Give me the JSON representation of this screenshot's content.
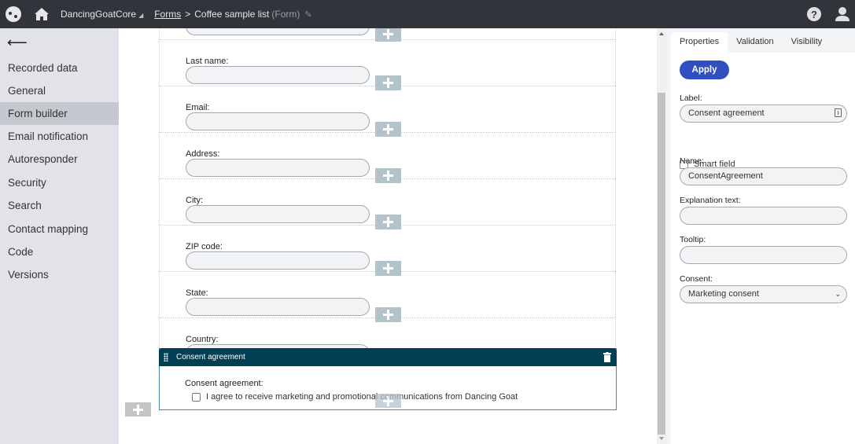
{
  "header": {
    "site_name": "DancingGoatCore",
    "breadcrumb_link": "Forms",
    "breadcrumb_separator": ">",
    "current_page": "Coffee sample list",
    "current_type": "(Form)",
    "icons": [
      "kentico-logo-icon",
      "home-icon",
      "pin-icon",
      "help-icon",
      "user-icon"
    ]
  },
  "sidebar": {
    "back_label": "⟵",
    "items": [
      {
        "label": "Recorded data",
        "active": false
      },
      {
        "label": "General",
        "active": false
      },
      {
        "label": "Form builder",
        "active": true
      },
      {
        "label": "Email notification",
        "active": false
      },
      {
        "label": "Autoresponder",
        "active": false
      },
      {
        "label": "Security",
        "active": false
      },
      {
        "label": "Search",
        "active": false
      },
      {
        "label": "Contact mapping",
        "active": false
      },
      {
        "label": "Code",
        "active": false
      },
      {
        "label": "Versions",
        "active": false
      }
    ]
  },
  "form": {
    "fields": [
      {
        "label": "",
        "value": ""
      },
      {
        "label": "Last name:",
        "value": ""
      },
      {
        "label": "Email:",
        "value": ""
      },
      {
        "label": "Address:",
        "value": ""
      },
      {
        "label": "City:",
        "value": ""
      },
      {
        "label": "ZIP code:",
        "value": ""
      },
      {
        "label": "State:",
        "value": ""
      },
      {
        "label": "Country:",
        "value": ""
      }
    ],
    "selected_widget": {
      "title": "Consent agreement",
      "field_label": "Consent agreement:",
      "consent_text": "I agree to receive marketing and promotional communications from Dancing Goat",
      "checked": false
    }
  },
  "panel": {
    "tabs": [
      {
        "label": "Properties",
        "active": true
      },
      {
        "label": "Validation",
        "active": false
      },
      {
        "label": "Visibility",
        "active": false
      }
    ],
    "apply_label": "Apply",
    "label_field": {
      "label": "Label:",
      "value": "Consent agreement"
    },
    "smart_field": {
      "label": "Smart field",
      "checked": false
    },
    "name_field": {
      "label": "Name:",
      "value": "ConsentAgreement"
    },
    "explanation_field": {
      "label": "Explanation text:",
      "value": ""
    },
    "tooltip_field": {
      "label": "Tooltip:",
      "value": ""
    },
    "consent_field": {
      "label": "Consent:",
      "value": "Marketing consent"
    }
  },
  "colors": {
    "topbar": "#31343b",
    "sidebar": "#e1e3e8",
    "sidebar_active": "#c5c8cf",
    "widget_header": "#003f54",
    "apply_button": "#2f4fc0",
    "add_button": "#b2c3cb"
  }
}
